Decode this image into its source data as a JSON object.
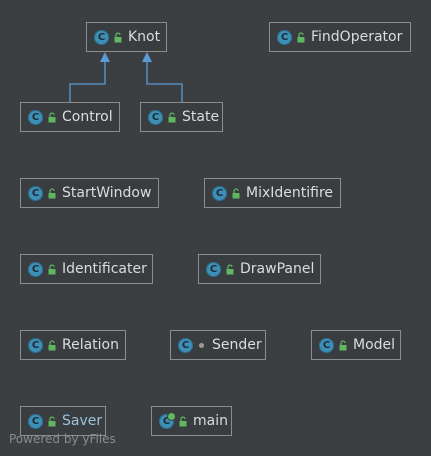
{
  "nodes": {
    "knot": "Knot",
    "findoperator": "FindOperator",
    "control": "Control",
    "state": "State",
    "startwindow": "StartWindow",
    "mixidentifire": "MixIdentifire",
    "identificater": "Identificater",
    "drawpanel": "DrawPanel",
    "relation": "Relation",
    "sender": "Sender",
    "model": "Model",
    "saver": "Saver",
    "main": "main"
  },
  "badge_letter": "C",
  "watermark": "Powered by yFiles",
  "colors": {
    "background": "#3c3f41",
    "node_border": "#8a8e91",
    "class_badge": "#3d8fb7",
    "edge": "#5b9bd5",
    "lock": "#5fb85f"
  },
  "icons": {
    "class": "class-icon",
    "public_visibility": "open-lock-icon",
    "package_visibility": "dot-icon",
    "main_class": "runnable-class-icon"
  }
}
